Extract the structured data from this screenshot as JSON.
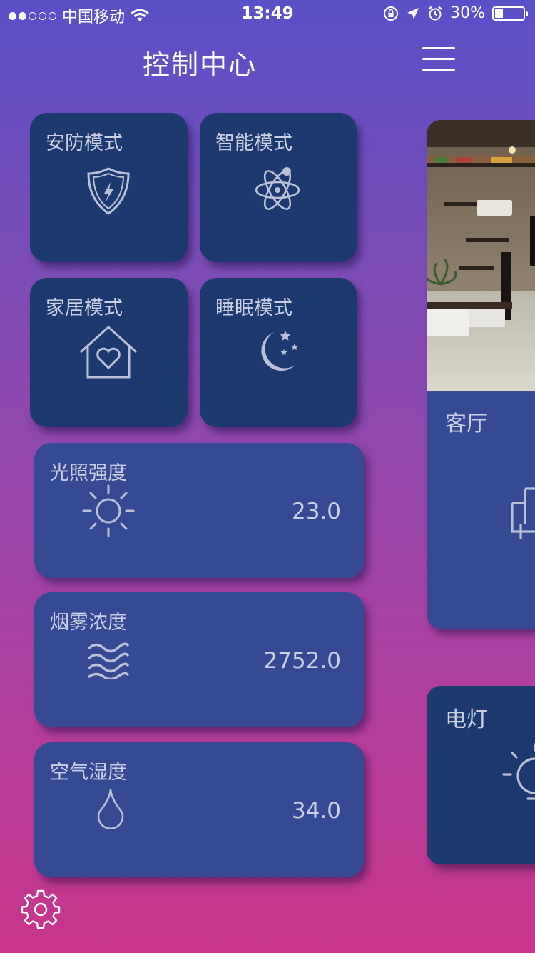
{
  "status_bar": {
    "carrier": "中国移动",
    "time": "13:49",
    "battery": "30%",
    "battery_level": 0.3
  },
  "header": {
    "title": "控制中心"
  },
  "modes": [
    {
      "label": "安防模式",
      "icon": "shield-bolt-icon"
    },
    {
      "label": "智能模式",
      "icon": "atom-icon"
    },
    {
      "label": "家居模式",
      "icon": "house-heart-icon"
    },
    {
      "label": "睡眠模式",
      "icon": "moon-stars-icon"
    }
  ],
  "sensors": [
    {
      "label": "光照强度",
      "value": "23.0",
      "icon": "sun-icon"
    },
    {
      "label": "烟雾浓度",
      "value": "2752.0",
      "icon": "waves-icon"
    },
    {
      "label": "空气湿度",
      "value": "34.0",
      "icon": "droplet-icon"
    }
  ],
  "rooms": [
    {
      "label": "客厅"
    }
  ],
  "devices": [
    {
      "label": "电灯",
      "icon": "bulb-icon"
    }
  ],
  "colors": {
    "tile_dark": "#1d3a6e",
    "tile_sensor": "#354a93",
    "icon": "#b9c1d6"
  }
}
